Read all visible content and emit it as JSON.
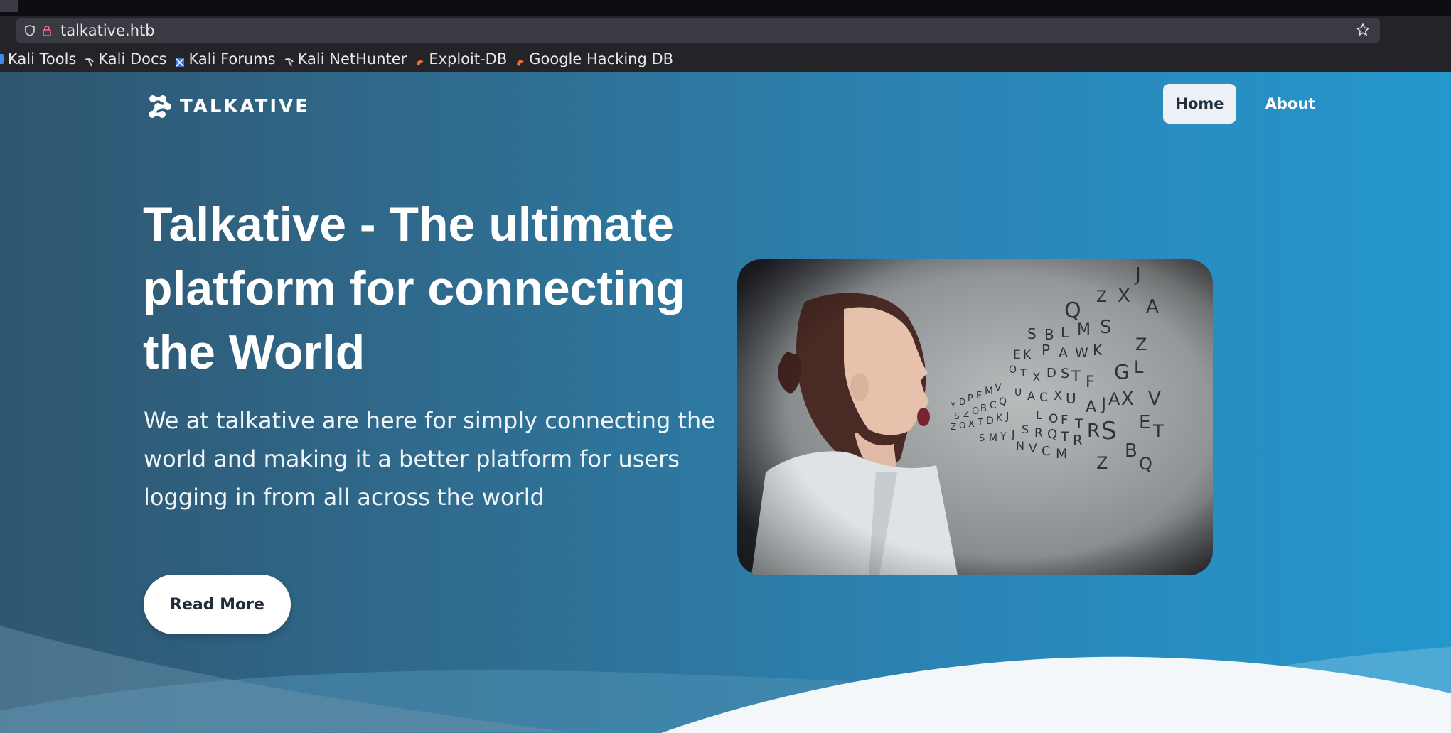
{
  "browser": {
    "url": "talkative.htb",
    "bookmarks": [
      {
        "label": "Kali Tools",
        "icon": "kali-tools-icon"
      },
      {
        "label": "Kali Docs",
        "icon": "kali-dragon-icon"
      },
      {
        "label": "Kali Forums",
        "icon": "kali-forums-icon"
      },
      {
        "label": "Kali NetHunter",
        "icon": "kali-dragon-icon"
      },
      {
        "label": "Exploit-DB",
        "icon": "exploit-db-icon"
      },
      {
        "label": "Google Hacking DB",
        "icon": "exploit-db-icon"
      }
    ]
  },
  "site": {
    "logo_text": "TALKATIVE",
    "nav": {
      "home": "Home",
      "about": "About"
    },
    "hero": {
      "title": "Talkative - The ultimate platform for connecting the World",
      "text": "We at talkative are here for simply connecting the world and making it a better platform for users logging in from all across the world",
      "button": "Read More"
    },
    "image_letters": [
      "J",
      "Q",
      "Z",
      "X",
      "A",
      "S",
      "B",
      "L",
      "M",
      "S",
      "Z",
      "E",
      "K",
      "P",
      "A",
      "W",
      "K",
      "G",
      "L",
      "O",
      "T",
      "X",
      "D",
      "S",
      "F",
      "A",
      "V",
      "U",
      "A",
      "J",
      "X",
      "E",
      "T",
      "R",
      "Q",
      "T",
      "S",
      "B",
      "Q",
      "N",
      "V",
      "C",
      "M",
      "Z",
      "Y",
      "D",
      "P"
    ]
  },
  "colors": {
    "chrome_bg": "#232328",
    "urlbar_bg": "#3a3b42",
    "hero_gradient_start": "#2f5670",
    "hero_gradient_end": "#2497cd",
    "button_bg": "#ffffff",
    "button_text": "#1f2d3b"
  }
}
